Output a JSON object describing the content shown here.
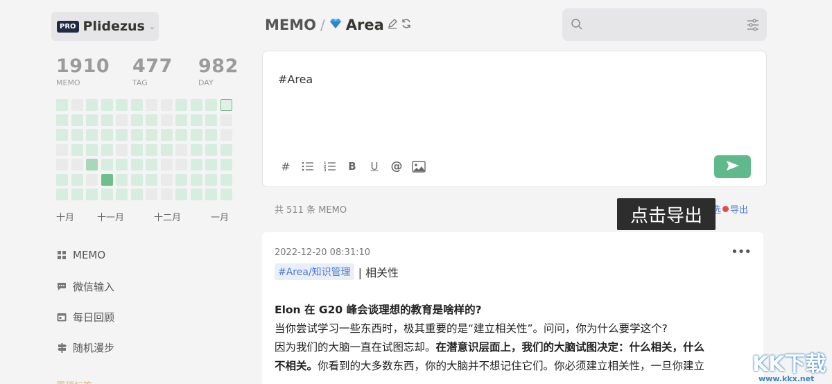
{
  "user": {
    "badge": "PRO",
    "name": "Plidezus"
  },
  "stats": [
    {
      "value": "1910",
      "label": "MEMO"
    },
    {
      "value": "477",
      "label": "TAG"
    },
    {
      "value": "982",
      "label": "DAY"
    }
  ],
  "heatmap_levels": [
    [
      1,
      0,
      1,
      1,
      1,
      1,
      0,
      0,
      1,
      1,
      1,
      "t"
    ],
    [
      1,
      1,
      1,
      1,
      0,
      1,
      1,
      0,
      1,
      1,
      1,
      0
    ],
    [
      1,
      1,
      1,
      1,
      1,
      1,
      1,
      1,
      1,
      1,
      1,
      0
    ],
    [
      0,
      1,
      1,
      1,
      0,
      1,
      1,
      1,
      0,
      1,
      1,
      1
    ],
    [
      0,
      0,
      2,
      1,
      1,
      1,
      1,
      0,
      0,
      1,
      1,
      1
    ],
    [
      1,
      1,
      0,
      3,
      1,
      1,
      1,
      0,
      1,
      1,
      1,
      1
    ],
    [
      1,
      1,
      1,
      1,
      1,
      1,
      0,
      0,
      1,
      1,
      1,
      1
    ]
  ],
  "months": [
    "十月",
    "十一月",
    "十二月",
    "一月"
  ],
  "nav": [
    {
      "label": "MEMO",
      "icon": "grid-icon"
    },
    {
      "label": "微信输入",
      "icon": "chat-icon"
    },
    {
      "label": "每日回顾",
      "icon": "calendar-icon"
    },
    {
      "label": "随机漫步",
      "icon": "signpost-icon"
    }
  ],
  "nav_faded": "置顶标签",
  "breadcrumb": {
    "root": "MEMO",
    "separator": "/",
    "current": "Area"
  },
  "editor": {
    "text": "#Area"
  },
  "toolbar": [
    "#",
    "bullet-list-icon",
    "numbered-list-icon",
    "B",
    "U",
    "@",
    "image-icon"
  ],
  "count_text": "共 511 条 MEMO",
  "links": {
    "filter": "筛选",
    "export": "导出"
  },
  "tooltip": "点击导出",
  "memo": {
    "timestamp": "2022-12-20 08:31:10",
    "tag": "#Area/知识管理",
    "tag_suffix": "| 相关性",
    "heading": "Elon 在 G20 峰会谈理想的教育是啥样的?",
    "line1": "当你尝试学习一些东西时，极其重要的是“建立相关性”。问问，你为什么要学这个?",
    "line2_plain": "因为我们的大脑一直在试图忘却。",
    "line2_bold": "在潜意识层面上，我们的大脑试图决定：什么相关，什么",
    "line3_bold": "不相关。",
    "line3_plain": "你看到的大多数东西，你的大脑并不想记住它们。你必须建立相关性，一旦你建立"
  },
  "watermark": {
    "text": "KK下载",
    "url": "www.kkx.net"
  },
  "colors": {
    "accent_green": "#5fb98a",
    "link_blue": "#4a7bd0"
  }
}
